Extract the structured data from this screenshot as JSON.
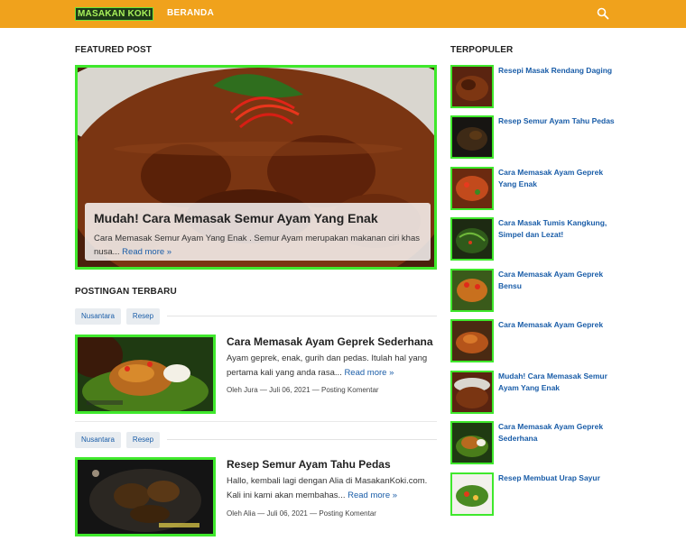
{
  "header": {
    "logo_text": "MASAKAN KOKI",
    "nav_home": "BERANDA",
    "search_icon": "search-icon",
    "bar_color": "#f0a21c"
  },
  "featured": {
    "section_title": "FEATURED POST",
    "title": "Mudah! Cara Memasak Semur Ayam Yang Enak",
    "snippet": "Cara Memasak Semur Ayam Yang Enak . Semur Ayam merupakan makanan ciri khas nusa...",
    "read_more": "Read more »"
  },
  "recent": {
    "section_title": "POSTINGAN TERBARU",
    "posts": [
      {
        "tags": [
          "Nusantara",
          "Resep"
        ],
        "title": "Cara Memasak Ayam Geprek Sederhana",
        "snippet": "Ayam geprek, enak, gurih dan pedas. Itulah hal yang pertama kali yang anda rasa...",
        "read_more": "Read more »",
        "author": "Oleh Jura",
        "date": "Juli 06, 2021",
        "comment": "Posting Komentar",
        "dash": "—"
      },
      {
        "tags": [
          "Nusantara",
          "Resep"
        ],
        "title": "Resep Semur Ayam Tahu Pedas",
        "snippet": "Hallo, kembali lagi dengan Alia di MasakanKoki.com. Kali ini kami akan membahas...",
        "read_more": "Read more »",
        "author": "Oleh Alia",
        "date": "Juli 06, 2021",
        "comment": "Posting Komentar",
        "dash": "—"
      }
    ]
  },
  "popular": {
    "section_title": "TERPOPULER",
    "items": [
      "Resepi Masak Rendang Daging",
      "Resep Semur Ayam Tahu Pedas",
      "Cara Memasak Ayam Geprek Yang Enak",
      "Cara Masak Tumis Kangkung, Simpel dan Lezat!",
      "Cara Memasak Ayam Geprek Bensu",
      "Cara Memasak Ayam Geprek",
      "Mudah! Cara Memasak Semur Ayam Yang Enak",
      "Cara Memasak Ayam Geprek Sederhana",
      "Resep Membuat Urap Sayur"
    ]
  },
  "colors": {
    "accent_green": "#3fe82c",
    "link_blue": "#1a5da8"
  }
}
